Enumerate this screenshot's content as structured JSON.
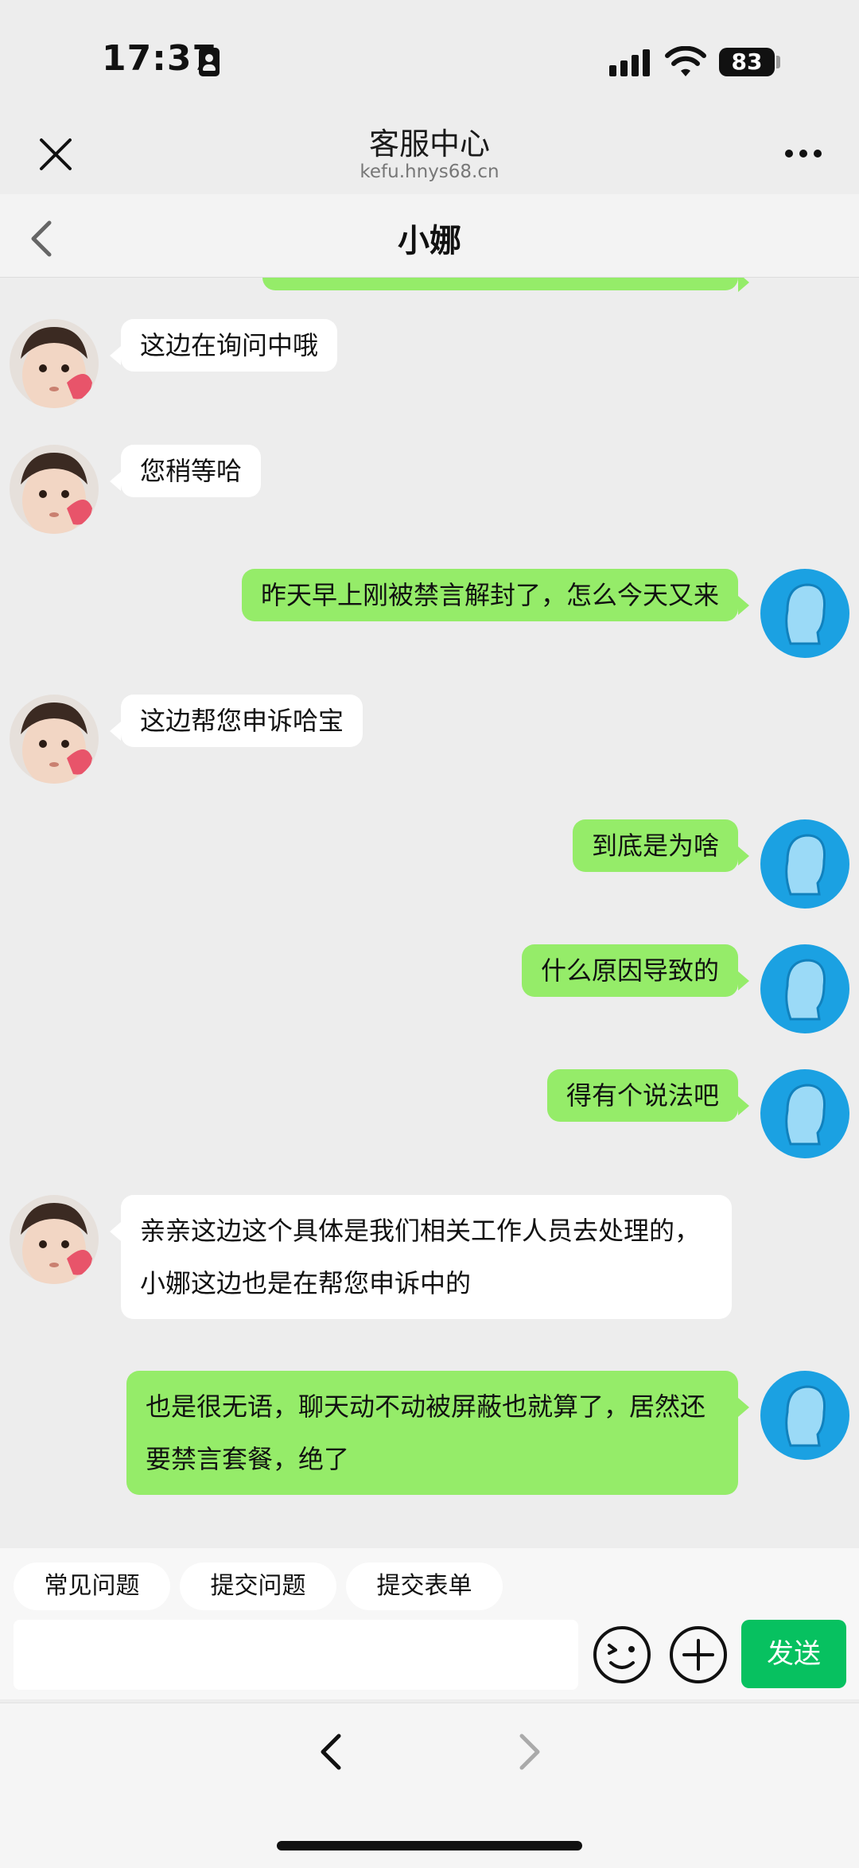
{
  "status_bar": {
    "time": "17:37",
    "battery": "83"
  },
  "web_header": {
    "title": "客服中心",
    "url": "kefu.hnys68.cn"
  },
  "chat": {
    "title": "小娜"
  },
  "messages": [
    {
      "side": "left",
      "text": "这边在询问中哦"
    },
    {
      "side": "left",
      "text": "您稍等哈"
    },
    {
      "side": "right",
      "text": "昨天早上刚被禁言解封了，怎么今天又来"
    },
    {
      "side": "left",
      "text": "这边帮您申诉哈宝"
    },
    {
      "side": "right",
      "text": "到底是为啥"
    },
    {
      "side": "right",
      "text": "什么原因导致的"
    },
    {
      "side": "right",
      "text": "得有个说法吧"
    },
    {
      "side": "left",
      "text": "亲亲这边这个具体是我们相关工作人员去处理的，小娜这边也是在帮您申诉中的"
    },
    {
      "side": "right",
      "text": "也是很无语，聊天动不动被屏蔽也就算了，居然还要禁言套餐，绝了"
    }
  ],
  "quick_replies": [
    "常见问题",
    "提交问题",
    "提交表单"
  ],
  "composer": {
    "value": "",
    "send_label": "发送"
  },
  "icons": {
    "close": "close-icon",
    "more": "more-icon",
    "back": "chevron-left-icon",
    "emoji": "emoji-icon",
    "plus": "plus-icon",
    "forward": "chevron-right-icon"
  },
  "colors": {
    "send": "#07C160",
    "bubble_self": "#95EC69",
    "bubble_agent": "#FFFFFF",
    "user_avatar": "#1BA1E2"
  }
}
